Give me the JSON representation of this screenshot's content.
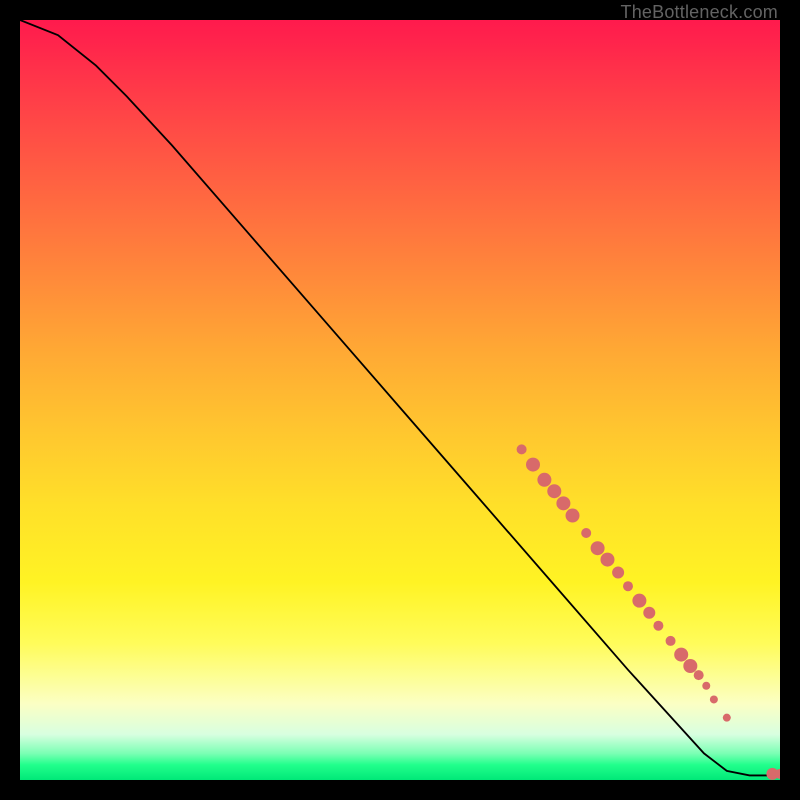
{
  "watermark": "TheBottleneck.com",
  "chart_data": {
    "type": "line",
    "title": "",
    "xlabel": "",
    "ylabel": "",
    "xlim": [
      0,
      100
    ],
    "ylim": [
      0,
      100
    ],
    "grid": false,
    "curve": [
      {
        "x": 0,
        "y": 100
      },
      {
        "x": 5,
        "y": 98
      },
      {
        "x": 10,
        "y": 94
      },
      {
        "x": 14,
        "y": 90
      },
      {
        "x": 20,
        "y": 83.5
      },
      {
        "x": 30,
        "y": 72
      },
      {
        "x": 40,
        "y": 60.5
      },
      {
        "x": 50,
        "y": 49
      },
      {
        "x": 60,
        "y": 37.5
      },
      {
        "x": 70,
        "y": 26
      },
      {
        "x": 80,
        "y": 14.5
      },
      {
        "x": 90,
        "y": 3.5
      },
      {
        "x": 93,
        "y": 1.2
      },
      {
        "x": 96,
        "y": 0.6
      },
      {
        "x": 100,
        "y": 0.6
      }
    ],
    "points": [
      {
        "x": 66.0,
        "y": 43.5,
        "r": 5
      },
      {
        "x": 67.5,
        "y": 41.5,
        "r": 7
      },
      {
        "x": 69.0,
        "y": 39.5,
        "r": 7
      },
      {
        "x": 70.3,
        "y": 38.0,
        "r": 7
      },
      {
        "x": 71.5,
        "y": 36.4,
        "r": 7
      },
      {
        "x": 72.7,
        "y": 34.8,
        "r": 7
      },
      {
        "x": 74.5,
        "y": 32.5,
        "r": 5
      },
      {
        "x": 76.0,
        "y": 30.5,
        "r": 7
      },
      {
        "x": 77.3,
        "y": 29.0,
        "r": 7
      },
      {
        "x": 78.7,
        "y": 27.3,
        "r": 6
      },
      {
        "x": 80.0,
        "y": 25.5,
        "r": 5
      },
      {
        "x": 81.5,
        "y": 23.6,
        "r": 7
      },
      {
        "x": 82.8,
        "y": 22.0,
        "r": 6
      },
      {
        "x": 84.0,
        "y": 20.3,
        "r": 5
      },
      {
        "x": 85.6,
        "y": 18.3,
        "r": 5
      },
      {
        "x": 87.0,
        "y": 16.5,
        "r": 7
      },
      {
        "x": 88.2,
        "y": 15.0,
        "r": 7
      },
      {
        "x": 89.3,
        "y": 13.8,
        "r": 5
      },
      {
        "x": 90.3,
        "y": 12.4,
        "r": 4
      },
      {
        "x": 91.3,
        "y": 10.6,
        "r": 4
      },
      {
        "x": 93.0,
        "y": 8.2,
        "r": 4
      },
      {
        "x": 99.0,
        "y": 0.8,
        "r": 6
      },
      {
        "x": 100.0,
        "y": 0.8,
        "r": 5
      }
    ],
    "colors": {
      "curve_stroke": "#000000",
      "point_fill": "#d86a6a"
    }
  }
}
